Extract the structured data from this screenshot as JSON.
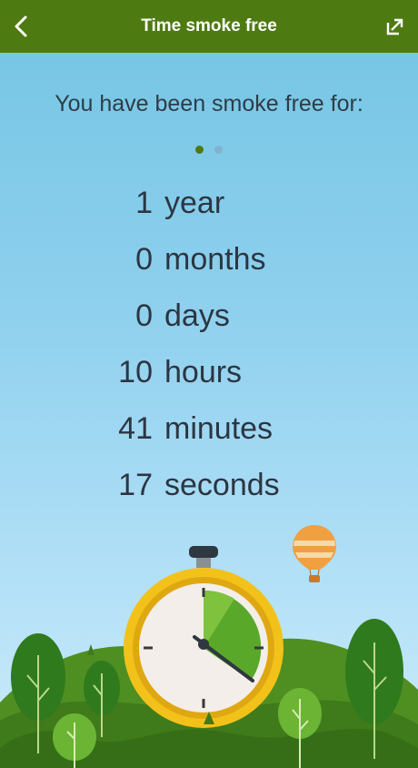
{
  "header": {
    "title": "Time smoke free",
    "back_icon": "back-chevron-icon",
    "share_icon": "share-icon"
  },
  "main": {
    "subtitle": "You have been smoke free for:",
    "page_indicator": {
      "count": 2,
      "active": 0,
      "active_color": "#4e7a12",
      "inactive_color": "#7fb3cc"
    },
    "durations": [
      {
        "value": "1",
        "unit": "year"
      },
      {
        "value": "0",
        "unit": "months"
      },
      {
        "value": "0",
        "unit": "days"
      },
      {
        "value": "10",
        "unit": "hours"
      },
      {
        "value": "41",
        "unit": "minutes"
      },
      {
        "value": "17",
        "unit": "seconds"
      }
    ]
  },
  "colors": {
    "header": "#4e7a12",
    "sky_top": "#72c4e2",
    "sky_bottom": "#cdebfa",
    "clock_ring": "#f2c21a",
    "clock_fill": "#5aa82a"
  }
}
